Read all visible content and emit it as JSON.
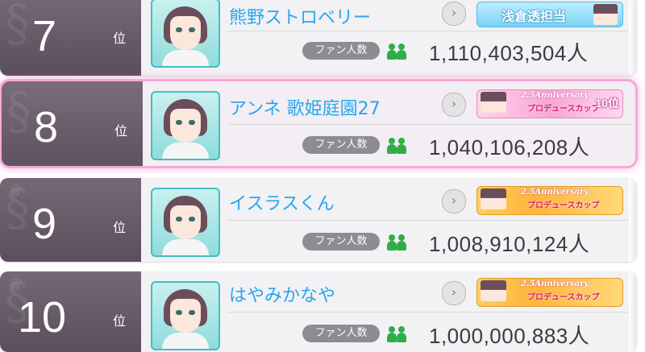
{
  "fan_label": "ファン人数",
  "rank_suffix": "位",
  "rows": [
    {
      "rank": "7",
      "name": "熊野ストロベリー",
      "fans": "1,110,403,504人",
      "badge": {
        "type": "blue",
        "text": "浅倉透担当"
      }
    },
    {
      "rank": "8",
      "name": "アンネ 歌姫庭園27",
      "fans": "1,040,106,208人",
      "badge": {
        "type": "pink",
        "text": "2.5Anniversary",
        "sub": "プロデュースカップ",
        "place": "10位"
      },
      "highlighted": true
    },
    {
      "rank": "9",
      "name": "イスラスくん",
      "fans": "1,008,910,124人",
      "badge": {
        "type": "gold",
        "text": "2.5Anniversary",
        "sub": "プロデュースカップ"
      }
    },
    {
      "rank": "10",
      "name": "はやみかなや",
      "fans": "1,000,000,883人",
      "badge": {
        "type": "gold",
        "text": "2.5Anniversary",
        "sub": "プロデュースカップ"
      }
    }
  ],
  "colors": {
    "name": "#26a7ee",
    "rank_bg": "#5b4f5c",
    "highlight": "#f7a8d7",
    "fan_icon": "#2fae48"
  },
  "icons": {
    "chevron": "chevron-right-icon",
    "fans": "fans-people-icon",
    "rank_bg": "swan-crest-icon"
  },
  "chevron_glyph": "›"
}
